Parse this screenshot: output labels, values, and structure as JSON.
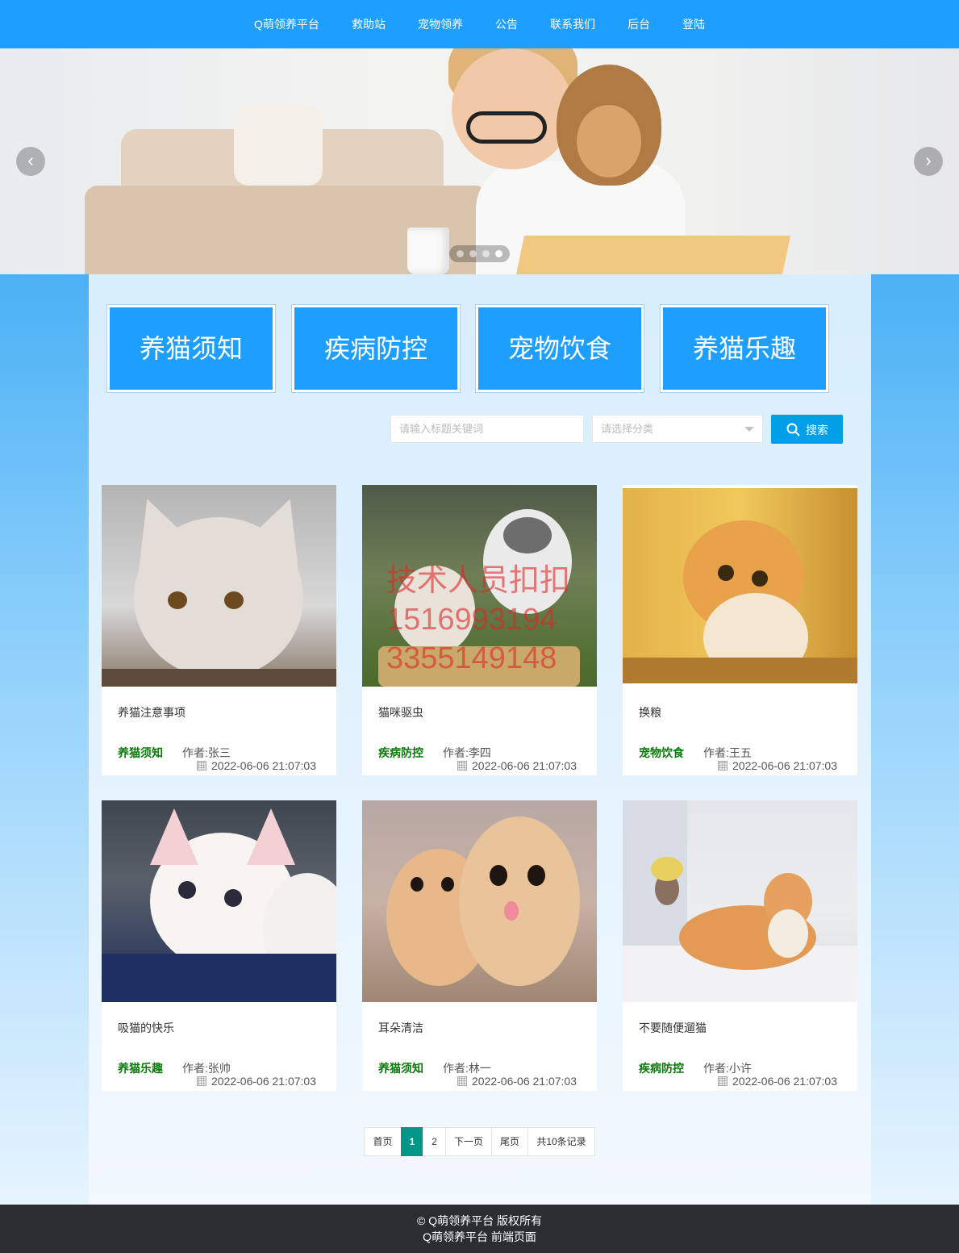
{
  "nav": {
    "items": [
      {
        "label": "Q萌领养平台"
      },
      {
        "label": "救助站"
      },
      {
        "label": "宠物领养"
      },
      {
        "label": "公告"
      },
      {
        "label": "联系我们"
      },
      {
        "label": "后台"
      },
      {
        "label": "登陆"
      }
    ]
  },
  "banner": {
    "prev_icon": "chevron-left-icon",
    "next_icon": "chevron-right-icon",
    "slide_count": 4,
    "active_slide": 4
  },
  "categories": [
    {
      "label": "养猫须知"
    },
    {
      "label": "疾病防控"
    },
    {
      "label": "宠物饮食"
    },
    {
      "label": "养猫乐趣"
    }
  ],
  "search": {
    "placeholder": "请输入标题关键词",
    "select_placeholder": "请选择分类",
    "button_label": "搜索",
    "button_icon": "search-icon"
  },
  "articles": [
    {
      "title": "养猫注意事项",
      "category": "养猫须知",
      "author": "作者:张三",
      "time": "2022-06-06 21:07:03"
    },
    {
      "title": "猫咪驱虫",
      "category": "疾病防控",
      "author": "作者:李四",
      "time": "2022-06-06 21:07:03",
      "watermark": [
        "技术人员扣扣",
        "1516993194",
        "3355149148"
      ]
    },
    {
      "title": "换粮",
      "category": "宠物饮食",
      "author": "作者:王五",
      "time": "2022-06-06 21:07:03"
    },
    {
      "title": "吸猫的快乐",
      "category": "养猫乐趣",
      "author": "作者:张帅",
      "time": "2022-06-06 21:07:03"
    },
    {
      "title": "耳朵清洁",
      "category": "养猫须知",
      "author": "作者:林一",
      "time": "2022-06-06 21:07:03"
    },
    {
      "title": "不要随便遛猫",
      "category": "疾病防控",
      "author": "作者:小许",
      "time": "2022-06-06 21:07:03"
    }
  ],
  "pagination": {
    "first": "首页",
    "pages": [
      "1",
      "2"
    ],
    "current": "1",
    "next": "下一页",
    "last": "尾页",
    "total": "共10条记录"
  },
  "footer": {
    "line1": "© Q萌领养平台 版权所有",
    "line2": "Q萌领养平台 前端页面"
  },
  "colors": {
    "nav": "#1e9fff",
    "tile": "#1e9fff",
    "search_button": "#009fe8",
    "category_text": "#0a7a0a",
    "pager_current": "#009688",
    "footer": "#2a2e33"
  }
}
